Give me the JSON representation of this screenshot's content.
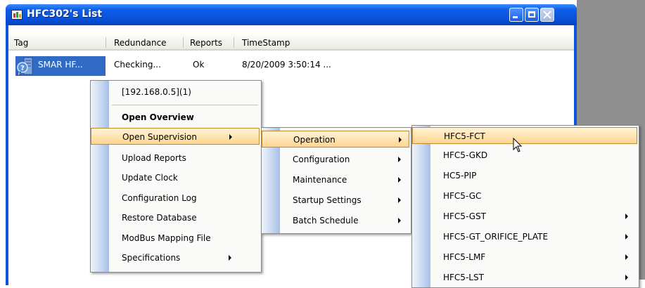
{
  "window": {
    "title": "HFC302's List"
  },
  "table": {
    "columns": [
      "Tag",
      "Redundance",
      "Reports",
      "TimeStamp"
    ],
    "rows": [
      {
        "tag": "SMAR HF...",
        "redundance": "Checking...",
        "reports": "Ok",
        "timestamp": "8/20/2009 3:50:14 ..."
      }
    ]
  },
  "context_menu": {
    "items": [
      {
        "label": "[192.168.0.5](1)"
      },
      {
        "label": "Open Overview"
      },
      {
        "label": "Open Supervision"
      },
      {
        "label": "Upload Reports"
      },
      {
        "label": "Update Clock"
      },
      {
        "label": "Configuration Log"
      },
      {
        "label": "Restore Database"
      },
      {
        "label": "ModBus Mapping File"
      },
      {
        "label": "Specifications"
      }
    ]
  },
  "supervision_menu": {
    "items": [
      {
        "label": "Operation"
      },
      {
        "label": "Configuration"
      },
      {
        "label": "Maintenance"
      },
      {
        "label": "Startup Settings"
      },
      {
        "label": "Batch Schedule"
      }
    ]
  },
  "operation_menu": {
    "items": [
      {
        "label": "HFC5-FCT"
      },
      {
        "label": "HFC5-GKD"
      },
      {
        "label": "HC5-PIP"
      },
      {
        "label": "HFC5-GC"
      },
      {
        "label": "HFC5-GST"
      },
      {
        "label": "HFC5-GT_ORIFICE_PLATE"
      },
      {
        "label": "HFC5-LMF"
      },
      {
        "label": "HFC5-LST"
      }
    ]
  },
  "colors": {
    "titlebar": "#0a55e0",
    "selection": "#316ac5",
    "menu_highlight": "#ffd690"
  }
}
